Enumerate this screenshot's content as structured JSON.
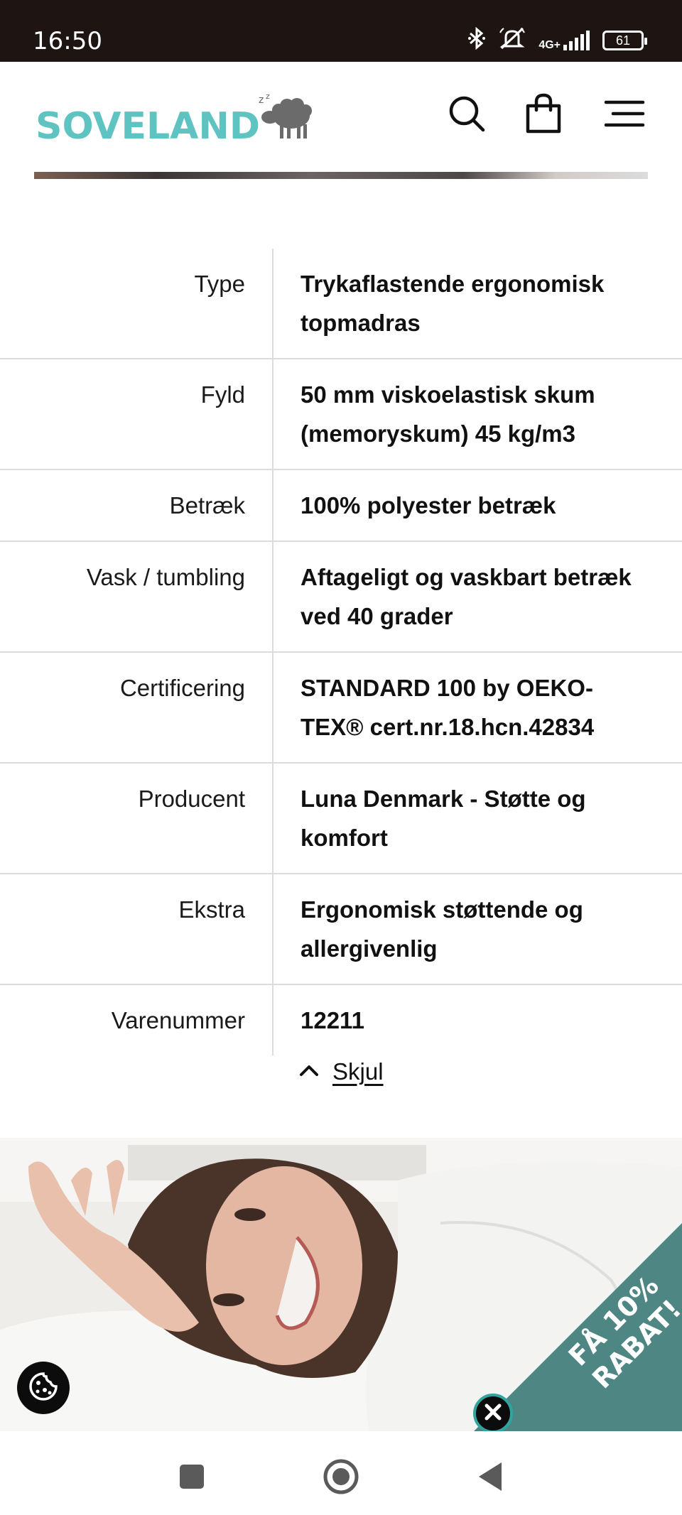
{
  "status_bar": {
    "time": "16:50",
    "network": "4G+",
    "battery": "61",
    "icons": [
      "bluetooth-icon",
      "mute-icon",
      "signal-icon",
      "battery-icon"
    ]
  },
  "header": {
    "logo_text": "SOVELAND",
    "logo_zz": "z z",
    "brand_color": "#5fc3c2",
    "icons": [
      "search-icon",
      "shopping-bag-icon",
      "hamburger-menu-icon"
    ]
  },
  "specs": [
    {
      "label": "Type",
      "value": "Trykaflastende ergonomisk topmadras"
    },
    {
      "label": "Fyld",
      "value": "50 mm viskoelastisk skum (memoryskum) 45 kg/m3"
    },
    {
      "label": "Betræk",
      "value": "100% polyester betræk"
    },
    {
      "label": "Vask / tumbling",
      "value": "Aftageligt og vaskbart betræk ved 40 grader"
    },
    {
      "label": "Certificering",
      "value": "STANDARD 100 by OEKO-TEX® cert.nr.18.hcn.42834"
    },
    {
      "label": "Producent",
      "value": "Luna Denmark - Støtte og komfort"
    },
    {
      "label": "Ekstra",
      "value": "Ergonomisk støttende og allergivenlig"
    },
    {
      "label": "Varenummer",
      "value": "12211"
    }
  ],
  "toggle": {
    "label": "Skjul",
    "icon": "chevron-up-icon"
  },
  "promo": {
    "text_line1": "FÅ 10%",
    "text_line2": "RABAT!",
    "color": "#4e8683"
  },
  "cookie": {
    "icon": "cookie-icon"
  },
  "navigation_bar": {
    "buttons": [
      "recent-apps-icon",
      "home-icon",
      "back-icon"
    ]
  }
}
